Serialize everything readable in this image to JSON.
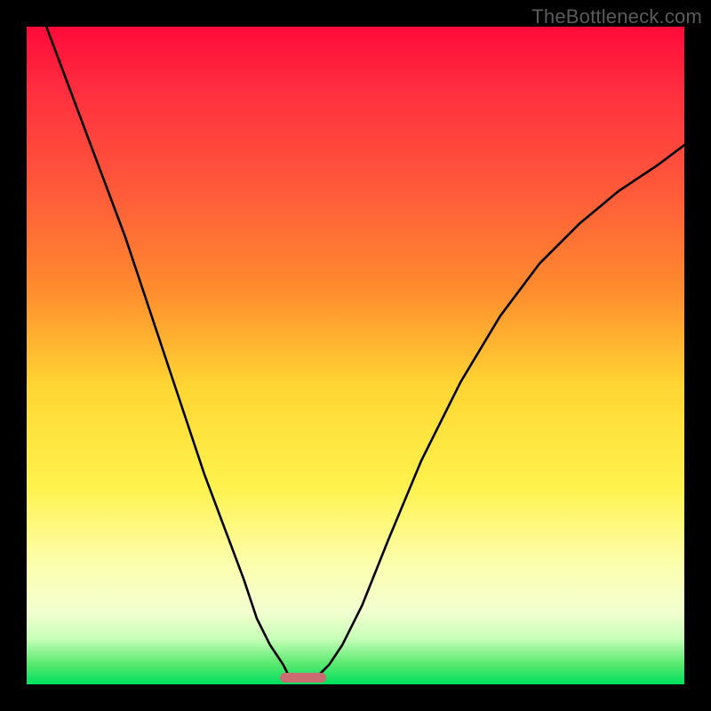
{
  "watermark": "TheBottleneck.com",
  "colors": {
    "frame_bg": "#000000",
    "gradient_top": "#ff0a3a",
    "gradient_bottom": "#00e060",
    "curve": "#000000",
    "marker": "#cb6b72",
    "watermark_text": "#5b5b5b"
  },
  "chart_data": {
    "type": "line",
    "title": "",
    "xlabel": "",
    "ylabel": "",
    "xlim": [
      0,
      100
    ],
    "ylim": [
      0,
      100
    ],
    "note": "No axis ticks or labels; values are positional estimates from pixels (0=left/bottom, 100=right/top).",
    "series": [
      {
        "name": "left-branch",
        "x": [
          3,
          6,
          9,
          12,
          15,
          18,
          21,
          24,
          27,
          30,
          33,
          35,
          37,
          39,
          40
        ],
        "y": [
          100,
          92,
          84,
          76,
          68,
          59,
          50,
          41,
          32,
          24,
          16,
          10,
          6,
          3,
          1
        ]
      },
      {
        "name": "right-branch",
        "x": [
          44,
          46,
          48,
          51,
          55,
          60,
          66,
          72,
          78,
          84,
          90,
          96,
          100
        ],
        "y": [
          1,
          3,
          6,
          12,
          22,
          34,
          46,
          56,
          64,
          70,
          75,
          79,
          82
        ]
      }
    ],
    "annotations": [
      {
        "name": "baseline-marker",
        "shape": "rounded-rect",
        "x_center": 42,
        "y_center": 1,
        "width": 7,
        "height": 1.5,
        "color": "#cb6b72"
      }
    ]
  }
}
